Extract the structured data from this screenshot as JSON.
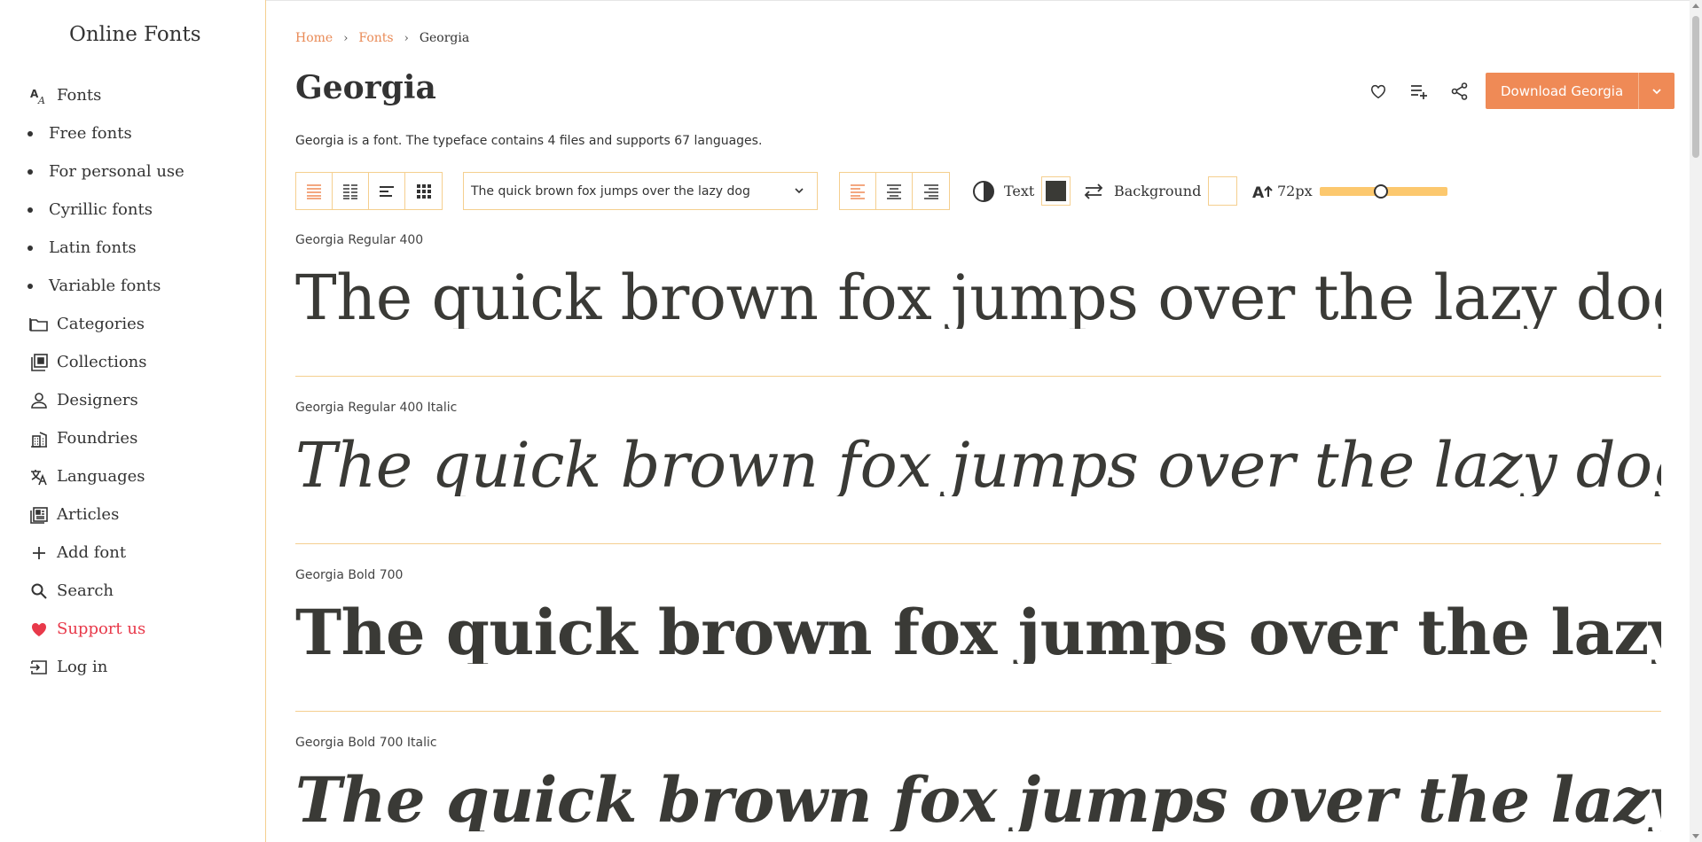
{
  "site": {
    "brand": "Online Fonts"
  },
  "sidebar": {
    "items": [
      {
        "label": "Fonts",
        "icon": "font-size-icon",
        "sub": false
      },
      {
        "label": "Free fonts",
        "icon": "bullet",
        "sub": true
      },
      {
        "label": "For personal use",
        "icon": "bullet",
        "sub": true
      },
      {
        "label": "Cyrillic fonts",
        "icon": "bullet",
        "sub": true
      },
      {
        "label": "Latin fonts",
        "icon": "bullet",
        "sub": true
      },
      {
        "label": "Variable fonts",
        "icon": "bullet",
        "sub": true
      },
      {
        "label": "Categories",
        "icon": "folder-icon",
        "sub": false
      },
      {
        "label": "Collections",
        "icon": "collections-icon",
        "sub": false
      },
      {
        "label": "Designers",
        "icon": "person-icon",
        "sub": false
      },
      {
        "label": "Foundries",
        "icon": "building-icon",
        "sub": false
      },
      {
        "label": "Languages",
        "icon": "translate-icon",
        "sub": false
      },
      {
        "label": "Articles",
        "icon": "newspaper-icon",
        "sub": false
      },
      {
        "label": "Add font",
        "icon": "plus-icon",
        "sub": false
      },
      {
        "label": "Search",
        "icon": "search-icon",
        "sub": false
      },
      {
        "label": "Support us",
        "icon": "heart-icon",
        "sub": false
      },
      {
        "label": "Log in",
        "icon": "login-icon",
        "sub": false
      }
    ]
  },
  "breadcrumb": {
    "home": "Home",
    "fonts": "Fonts",
    "current": "Georgia",
    "separator": "›"
  },
  "page": {
    "title": "Georgia",
    "description": "Georgia is a font. The typeface contains 4 files and supports 67 languages."
  },
  "actions": {
    "favorite_icon": "heart-outline-icon",
    "add_to_list_icon": "playlist-add-icon",
    "share_icon": "share-icon",
    "download_label": "Download Georgia",
    "download_caret_icon": "chevron-down-icon"
  },
  "toolbar": {
    "view_modes": [
      "list-view-icon",
      "columns-view-icon",
      "paragraph-view-icon",
      "grid-view-icon"
    ],
    "active_view": 0,
    "sample_text": "The quick brown fox jumps over the lazy dog",
    "align_modes": [
      "align-left-icon",
      "align-center-icon",
      "align-right-icon"
    ],
    "active_align": 0,
    "text_color_label": "Text",
    "text_color": "#3a3a36",
    "background_label": "Background",
    "background_color": "#ffffff",
    "size_label": "72px",
    "size_fraction": 0.48
  },
  "previews": [
    {
      "name": "Georgia Regular 400",
      "text": "The quick brown fox jumps over the lazy dog",
      "weight": "normal",
      "style": "normal"
    },
    {
      "name": "Georgia Regular 400 Italic",
      "text": "The quick brown fox jumps over the lazy dog",
      "weight": "normal",
      "style": "italic"
    },
    {
      "name": "Georgia Bold 700",
      "text": "The quick brown fox jumps over the lazy dog",
      "weight": "bold",
      "style": "normal"
    },
    {
      "name": "Georgia Bold 700 Italic",
      "text": "The quick brown fox jumps over the lazy dog",
      "weight": "bold",
      "style": "italic"
    }
  ],
  "colors": {
    "accent": "#ef8a56",
    "border": "#f5cf8f",
    "support": "#e8394a",
    "slider": "#fcc86e"
  }
}
